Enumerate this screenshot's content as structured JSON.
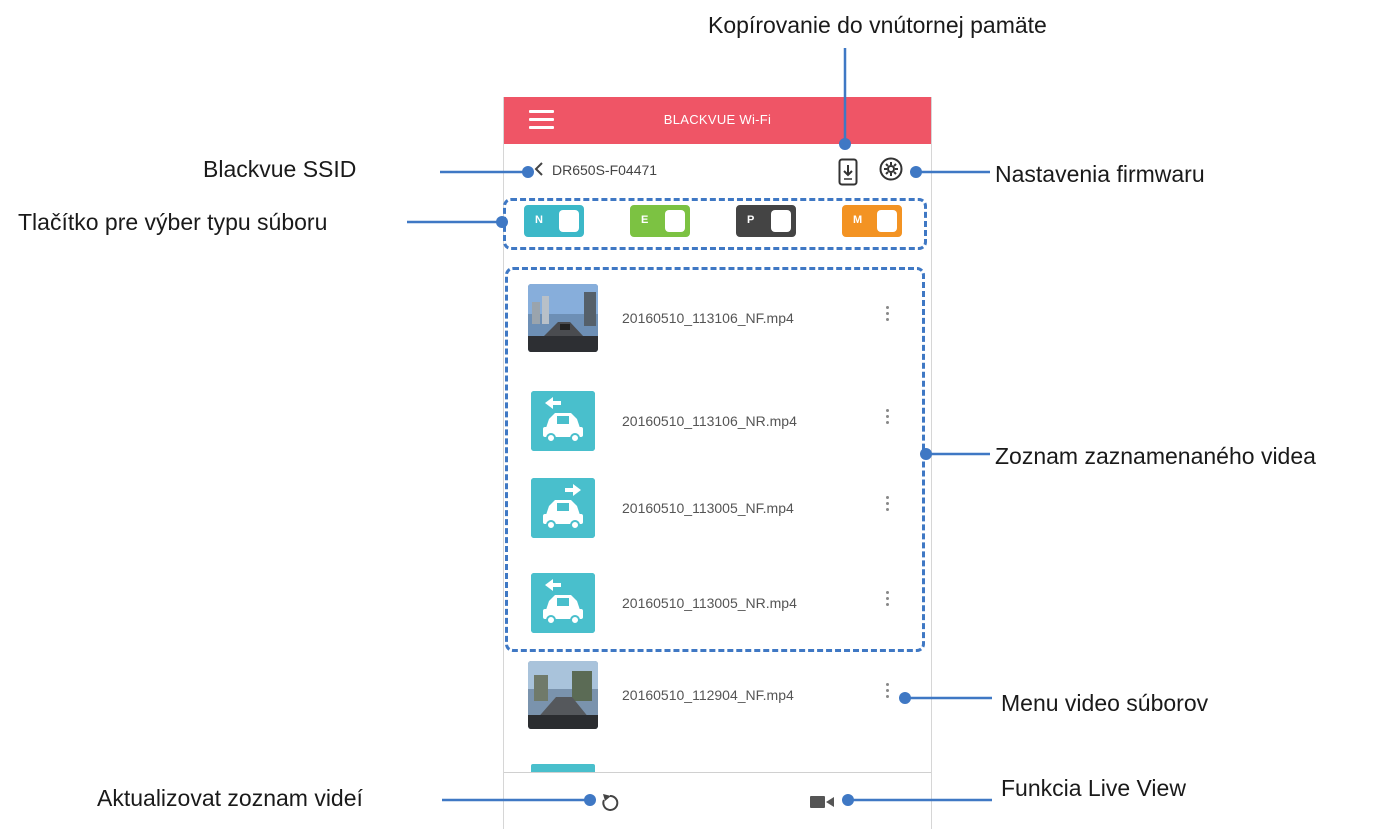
{
  "callouts": {
    "copy_internal": "Kopírovanie do vnútornej pamäte",
    "ssid": "Blackvue SSID",
    "firmware_settings": "Nastavenia firmwaru",
    "file_type_toggle": "Tlačítko pre výber typu súboru",
    "recorded_list": "Zoznam zaznamenaného videa",
    "file_menu": "Menu video súborov",
    "refresh_list": "Aktualizovat zoznam videí",
    "live_view": "Funkcia Live View"
  },
  "app": {
    "title": "BLACKVUE Wi-Fi",
    "ssid": "DR650S-F04471",
    "accent_color": "#ef5566",
    "callout_color": "#3f78c4"
  },
  "toggles": [
    {
      "label": "N",
      "color": "#3cb8c8"
    },
    {
      "label": "E",
      "color": "#7cc242"
    },
    {
      "label": "P",
      "color": "#444444"
    },
    {
      "label": "M",
      "color": "#f39323"
    }
  ],
  "videos": [
    {
      "filename": "20160510_113106_NF.mp4",
      "thumb": "front-camera-photo"
    },
    {
      "filename": "20160510_113106_NR.mp4",
      "thumb": "rear-camera-icon"
    },
    {
      "filename": "20160510_113005_NF.mp4",
      "thumb": "rear-camera-icon"
    },
    {
      "filename": "20160510_113005_NR.mp4",
      "thumb": "rear-camera-icon"
    },
    {
      "filename": "20160510_112904_NF.mp4",
      "thumb": "front-camera-photo"
    }
  ],
  "icons": {
    "menu": "hamburger-menu-icon",
    "back": "chevron-left-icon",
    "copy": "phone-download-icon",
    "firmware": "gear-settings-icon",
    "more": "vertical-dots-icon",
    "refresh": "refresh-icon",
    "live": "video-camera-icon"
  }
}
